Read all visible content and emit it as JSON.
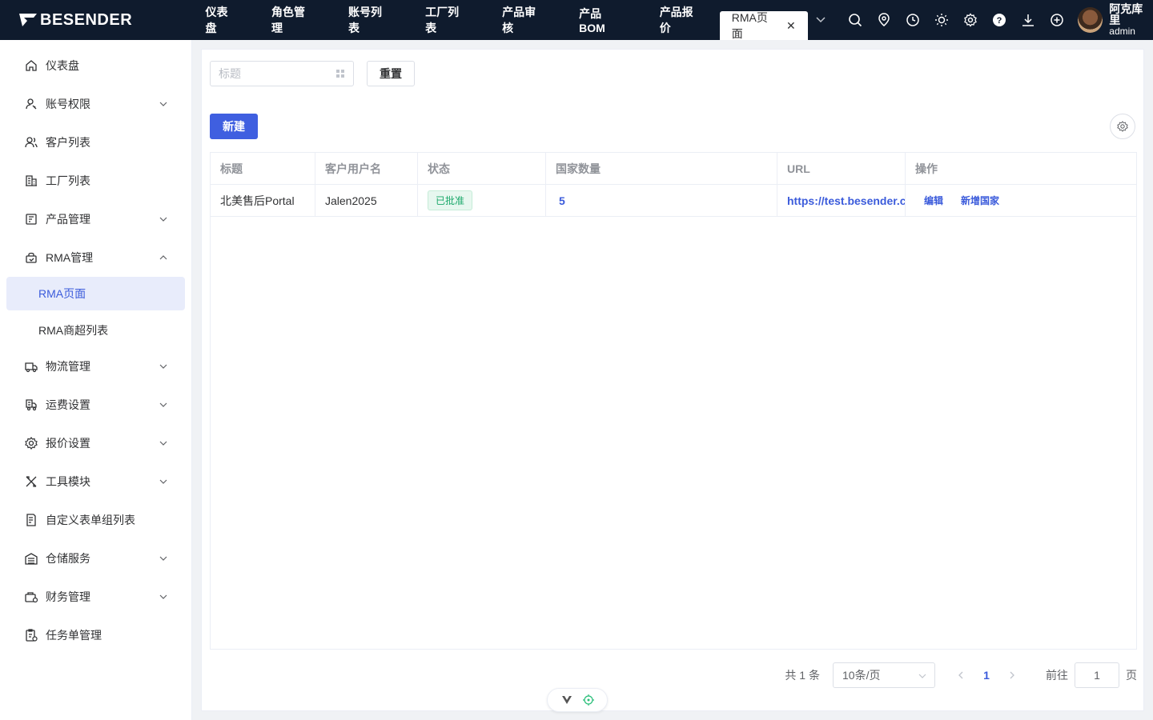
{
  "app": {
    "logo_text": "BESENDER"
  },
  "tabs": [
    {
      "label": "仪表盘"
    },
    {
      "label": "角色管理"
    },
    {
      "label": "账号列表"
    },
    {
      "label": "工厂列表"
    },
    {
      "label": "产品审核"
    },
    {
      "label": "产品BOM"
    },
    {
      "label": "产品报价"
    },
    {
      "label": "RMA页面",
      "active": true
    }
  ],
  "user": {
    "name": "阿克库里",
    "role": "admin"
  },
  "sidebar": {
    "items": [
      {
        "label": "仪表盘",
        "icon": "home-icon"
      },
      {
        "label": "账号权限",
        "icon": "user-key-icon",
        "expandable": true
      },
      {
        "label": "客户列表",
        "icon": "users-icon"
      },
      {
        "label": "工厂列表",
        "icon": "building-icon"
      },
      {
        "label": "产品管理",
        "icon": "product-icon",
        "expandable": true
      },
      {
        "label": "RMA管理",
        "icon": "rma-icon",
        "expandable": true,
        "expanded": true
      },
      {
        "label": "物流管理",
        "icon": "truck-icon",
        "expandable": true
      },
      {
        "label": "运费设置",
        "icon": "shipping-icon",
        "expandable": true
      },
      {
        "label": "报价设置",
        "icon": "gear-icon",
        "expandable": true
      },
      {
        "label": "工具模块",
        "icon": "tools-icon",
        "expandable": true
      },
      {
        "label": "自定义表单组列表",
        "icon": "form-icon"
      },
      {
        "label": "仓储服务",
        "icon": "warehouse-icon",
        "expandable": true
      },
      {
        "label": "财务管理",
        "icon": "finance-icon",
        "expandable": true
      },
      {
        "label": "任务单管理",
        "icon": "task-icon"
      }
    ],
    "rma_sub": [
      {
        "label": "RMA页面",
        "active": true
      },
      {
        "label": "RMA商超列表"
      }
    ]
  },
  "filter": {
    "placeholder": "标题",
    "reset_label": "重置"
  },
  "toolbar": {
    "new_label": "新建"
  },
  "table": {
    "headers": [
      "标题",
      "客户用户名",
      "状态",
      "国家数量",
      "URL",
      "操作"
    ],
    "rows": [
      {
        "title": "北美售后Portal",
        "username": "Jalen2025",
        "status": "已批准",
        "country_count": "5",
        "url": "https://test.besender.com",
        "actions": [
          "编辑",
          "新增国家"
        ]
      }
    ]
  },
  "pagination": {
    "total_text": "共 1 条",
    "page_size": "10条/页",
    "current_page": "1",
    "goto_label": "前往",
    "goto_value": "1",
    "page_suffix": "页"
  },
  "colors": {
    "accent": "#3f5fe0",
    "topbar": "#0f1b2d",
    "success": "#1aa86a"
  }
}
